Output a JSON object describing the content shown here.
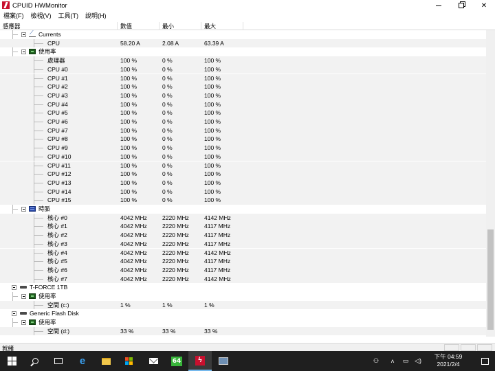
{
  "window": {
    "title": "CPUID HWMonitor",
    "controls": {
      "minimize": "",
      "maximize": "",
      "close": "✕"
    }
  },
  "menu": [
    {
      "label": "檔案(F)"
    },
    {
      "label": "檢視(V)"
    },
    {
      "label": "工具(T)"
    },
    {
      "label": "說明(H)"
    }
  ],
  "columns": {
    "sensor": "感應器",
    "value": "數值",
    "min": "最小",
    "max": "最大"
  },
  "tree": [
    {
      "kind": "group",
      "level": 1,
      "icon": "current-icon",
      "label": "Currents"
    },
    {
      "kind": "sensor",
      "level": 2,
      "label": "CPU",
      "value": "58.20 A",
      "min": "2.08 A",
      "max": "63.39 A"
    },
    {
      "kind": "group",
      "level": 1,
      "icon": "utilization-icon",
      "label": "使用率"
    },
    {
      "kind": "sensor",
      "level": 2,
      "label": "處理器",
      "value": "100 %",
      "min": "0 %",
      "max": "100 %"
    },
    {
      "kind": "sensor",
      "level": 2,
      "label": "CPU #0",
      "value": "100 %",
      "min": "0 %",
      "max": "100 %"
    },
    {
      "kind": "sensor",
      "level": 2,
      "label": "CPU #1",
      "value": "100 %",
      "min": "0 %",
      "max": "100 %"
    },
    {
      "kind": "sensor",
      "level": 2,
      "label": "CPU #2",
      "value": "100 %",
      "min": "0 %",
      "max": "100 %"
    },
    {
      "kind": "sensor",
      "level": 2,
      "label": "CPU #3",
      "value": "100 %",
      "min": "0 %",
      "max": "100 %"
    },
    {
      "kind": "sensor",
      "level": 2,
      "label": "CPU #4",
      "value": "100 %",
      "min": "0 %",
      "max": "100 %"
    },
    {
      "kind": "sensor",
      "level": 2,
      "label": "CPU #5",
      "value": "100 %",
      "min": "0 %",
      "max": "100 %"
    },
    {
      "kind": "sensor",
      "level": 2,
      "label": "CPU #6",
      "value": "100 %",
      "min": "0 %",
      "max": "100 %"
    },
    {
      "kind": "sensor",
      "level": 2,
      "label": "CPU #7",
      "value": "100 %",
      "min": "0 %",
      "max": "100 %"
    },
    {
      "kind": "sensor",
      "level": 2,
      "label": "CPU #8",
      "value": "100 %",
      "min": "0 %",
      "max": "100 %"
    },
    {
      "kind": "sensor",
      "level": 2,
      "label": "CPU #9",
      "value": "100 %",
      "min": "0 %",
      "max": "100 %"
    },
    {
      "kind": "sensor",
      "level": 2,
      "label": "CPU #10",
      "value": "100 %",
      "min": "0 %",
      "max": "100 %"
    },
    {
      "kind": "sensor",
      "level": 2,
      "label": "CPU #11",
      "value": "100 %",
      "min": "0 %",
      "max": "100 %"
    },
    {
      "kind": "sensor",
      "level": 2,
      "label": "CPU #12",
      "value": "100 %",
      "min": "0 %",
      "max": "100 %"
    },
    {
      "kind": "sensor",
      "level": 2,
      "label": "CPU #13",
      "value": "100 %",
      "min": "0 %",
      "max": "100 %"
    },
    {
      "kind": "sensor",
      "level": 2,
      "label": "CPU #14",
      "value": "100 %",
      "min": "0 %",
      "max": "100 %"
    },
    {
      "kind": "sensor",
      "level": 2,
      "label": "CPU #15",
      "value": "100 %",
      "min": "0 %",
      "max": "100 %"
    },
    {
      "kind": "group",
      "level": 1,
      "icon": "clock-icon",
      "label": "時脈"
    },
    {
      "kind": "sensor",
      "level": 2,
      "label": "核心 #0",
      "value": "4042 MHz",
      "min": "2220 MHz",
      "max": "4142 MHz"
    },
    {
      "kind": "sensor",
      "level": 2,
      "label": "核心 #1",
      "value": "4042 MHz",
      "min": "2220 MHz",
      "max": "4117 MHz"
    },
    {
      "kind": "sensor",
      "level": 2,
      "label": "核心 #2",
      "value": "4042 MHz",
      "min": "2220 MHz",
      "max": "4117 MHz"
    },
    {
      "kind": "sensor",
      "level": 2,
      "label": "核心 #3",
      "value": "4042 MHz",
      "min": "2220 MHz",
      "max": "4117 MHz"
    },
    {
      "kind": "sensor",
      "level": 2,
      "label": "核心 #4",
      "value": "4042 MHz",
      "min": "2220 MHz",
      "max": "4142 MHz"
    },
    {
      "kind": "sensor",
      "level": 2,
      "label": "核心 #5",
      "value": "4042 MHz",
      "min": "2220 MHz",
      "max": "4117 MHz"
    },
    {
      "kind": "sensor",
      "level": 2,
      "label": "核心 #6",
      "value": "4042 MHz",
      "min": "2220 MHz",
      "max": "4117 MHz"
    },
    {
      "kind": "sensor",
      "level": 2,
      "label": "核心 #7",
      "value": "4042 MHz",
      "min": "2220 MHz",
      "max": "4142 MHz"
    },
    {
      "kind": "device",
      "level": 0,
      "icon": "disk-icon",
      "label": "T-FORCE 1TB"
    },
    {
      "kind": "group",
      "level": 1,
      "icon": "utilization-icon",
      "label": "使用率"
    },
    {
      "kind": "sensor",
      "level": 2,
      "label": "空間 (c:)",
      "value": "1 %",
      "min": "1 %",
      "max": "1 %"
    },
    {
      "kind": "device",
      "level": 0,
      "icon": "disk-icon",
      "label": "Generic Flash Disk"
    },
    {
      "kind": "group",
      "level": 1,
      "icon": "utilization-icon",
      "label": "使用率"
    },
    {
      "kind": "sensor",
      "level": 2,
      "label": "空間 (d:)",
      "value": "33 %",
      "min": "33 %",
      "max": "33 %"
    }
  ],
  "status": {
    "text": "就緒"
  },
  "taskbar": {
    "clock_time": "下午 04:59",
    "clock_date": "2021/2/4",
    "aida_label": "64",
    "colors": {
      "taskbar_bg": "#1f1f1f",
      "accent": "#76b9ed"
    }
  }
}
